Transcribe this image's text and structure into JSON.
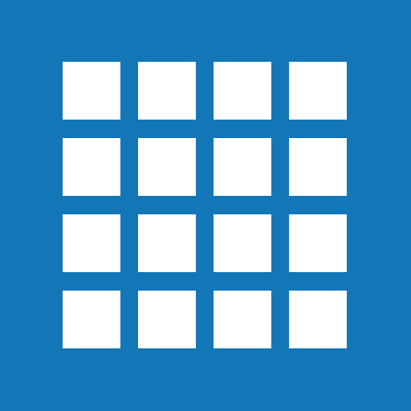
{
  "icon": {
    "name": "grid-app-icon",
    "background_color": "#1276b7",
    "tile_color": "#ffffff",
    "grid": {
      "rows": 4,
      "columns": 4
    }
  }
}
